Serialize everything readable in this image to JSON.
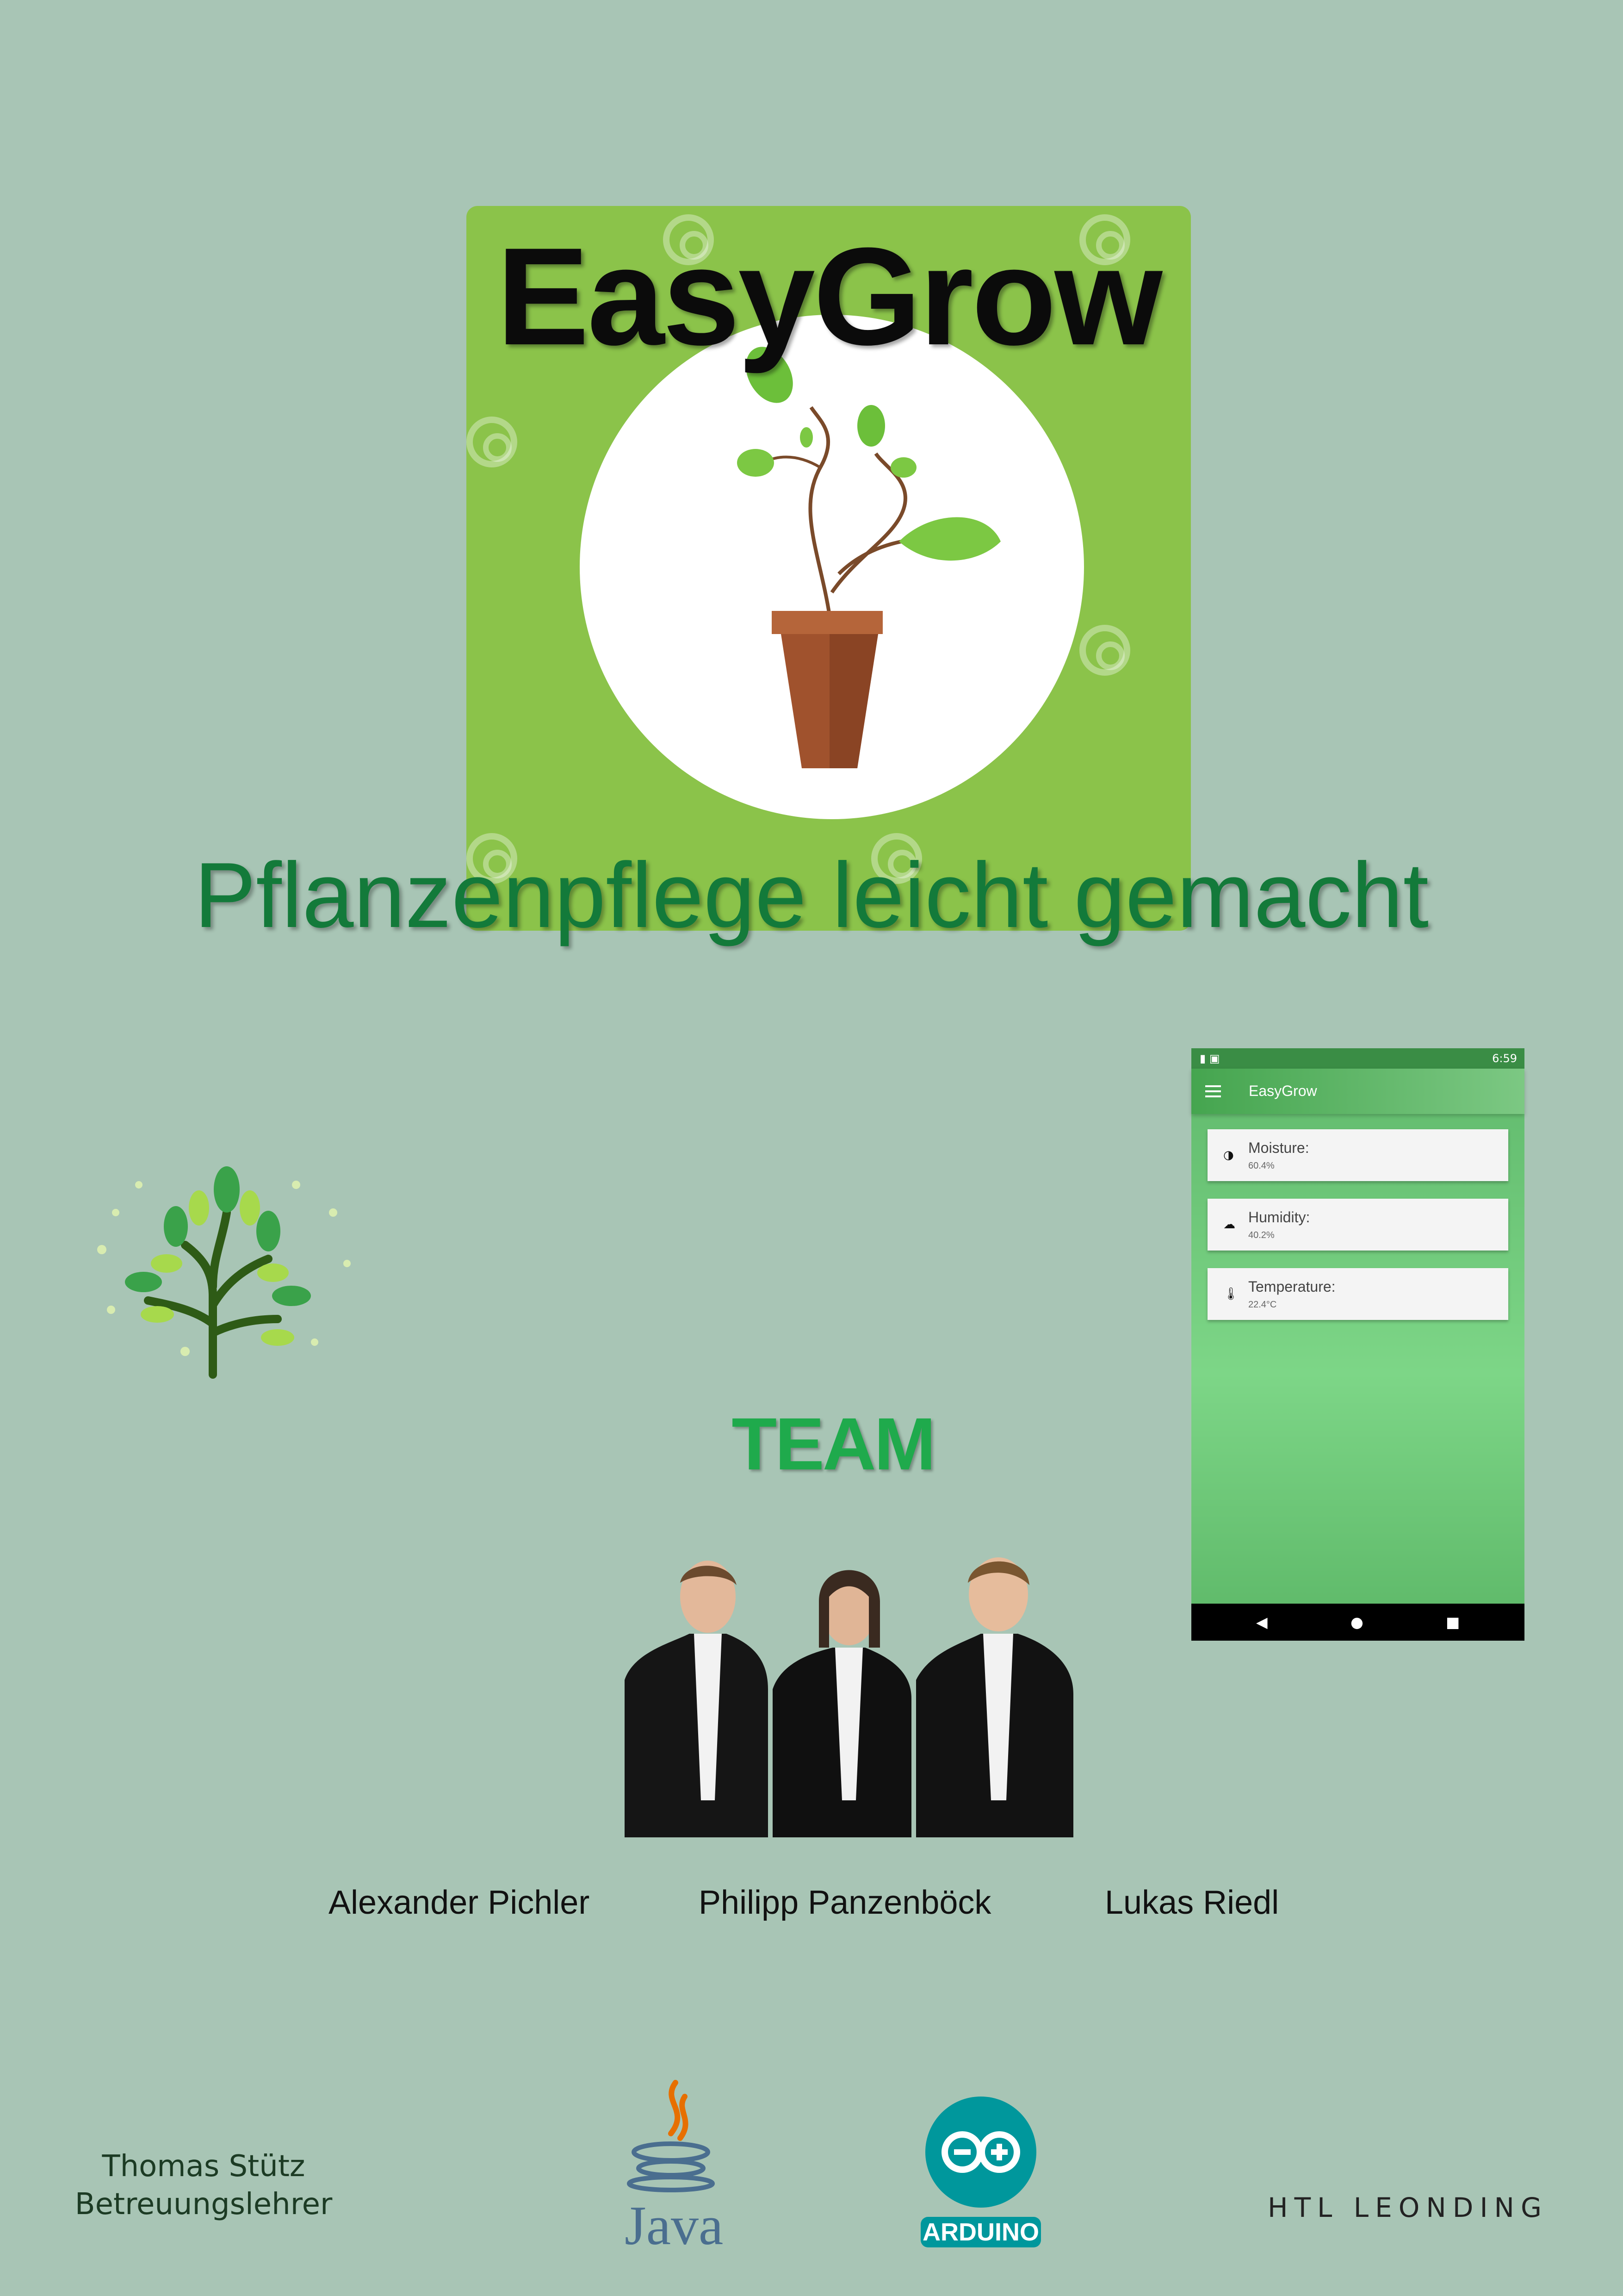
{
  "poster": {
    "title": "EasyGrow",
    "tagline": "Pflanzenpflege leicht gemacht",
    "team_heading": "TEAM",
    "members": [
      "Alexander Pichler",
      "Philipp Panzenböck",
      "Lukas Riedl"
    ],
    "teacher_name": "Thomas Stütz",
    "teacher_role": "Betreuungslehrer",
    "java_label": "Java",
    "arduino_label": "ARDUINO",
    "school_name": "HTL LEONDING"
  },
  "phone": {
    "status_time": "6:59",
    "app_title": "EasyGrow",
    "cards": [
      {
        "label": "Moisture:",
        "value": "60.4%",
        "icon": "drop-icon"
      },
      {
        "label": "Humidity:",
        "value": "40.2%",
        "icon": "cloud-icon"
      },
      {
        "label": "Temperature:",
        "value": "22.4°C",
        "icon": "thermometer-icon"
      }
    ]
  },
  "colors": {
    "background": "#a8c5b5",
    "logo_green": "#8bc34a",
    "tagline_green": "#137a3a",
    "team_green": "#1faa4c",
    "phone_green": "#5fb86b",
    "arduino_teal": "#00979c"
  }
}
